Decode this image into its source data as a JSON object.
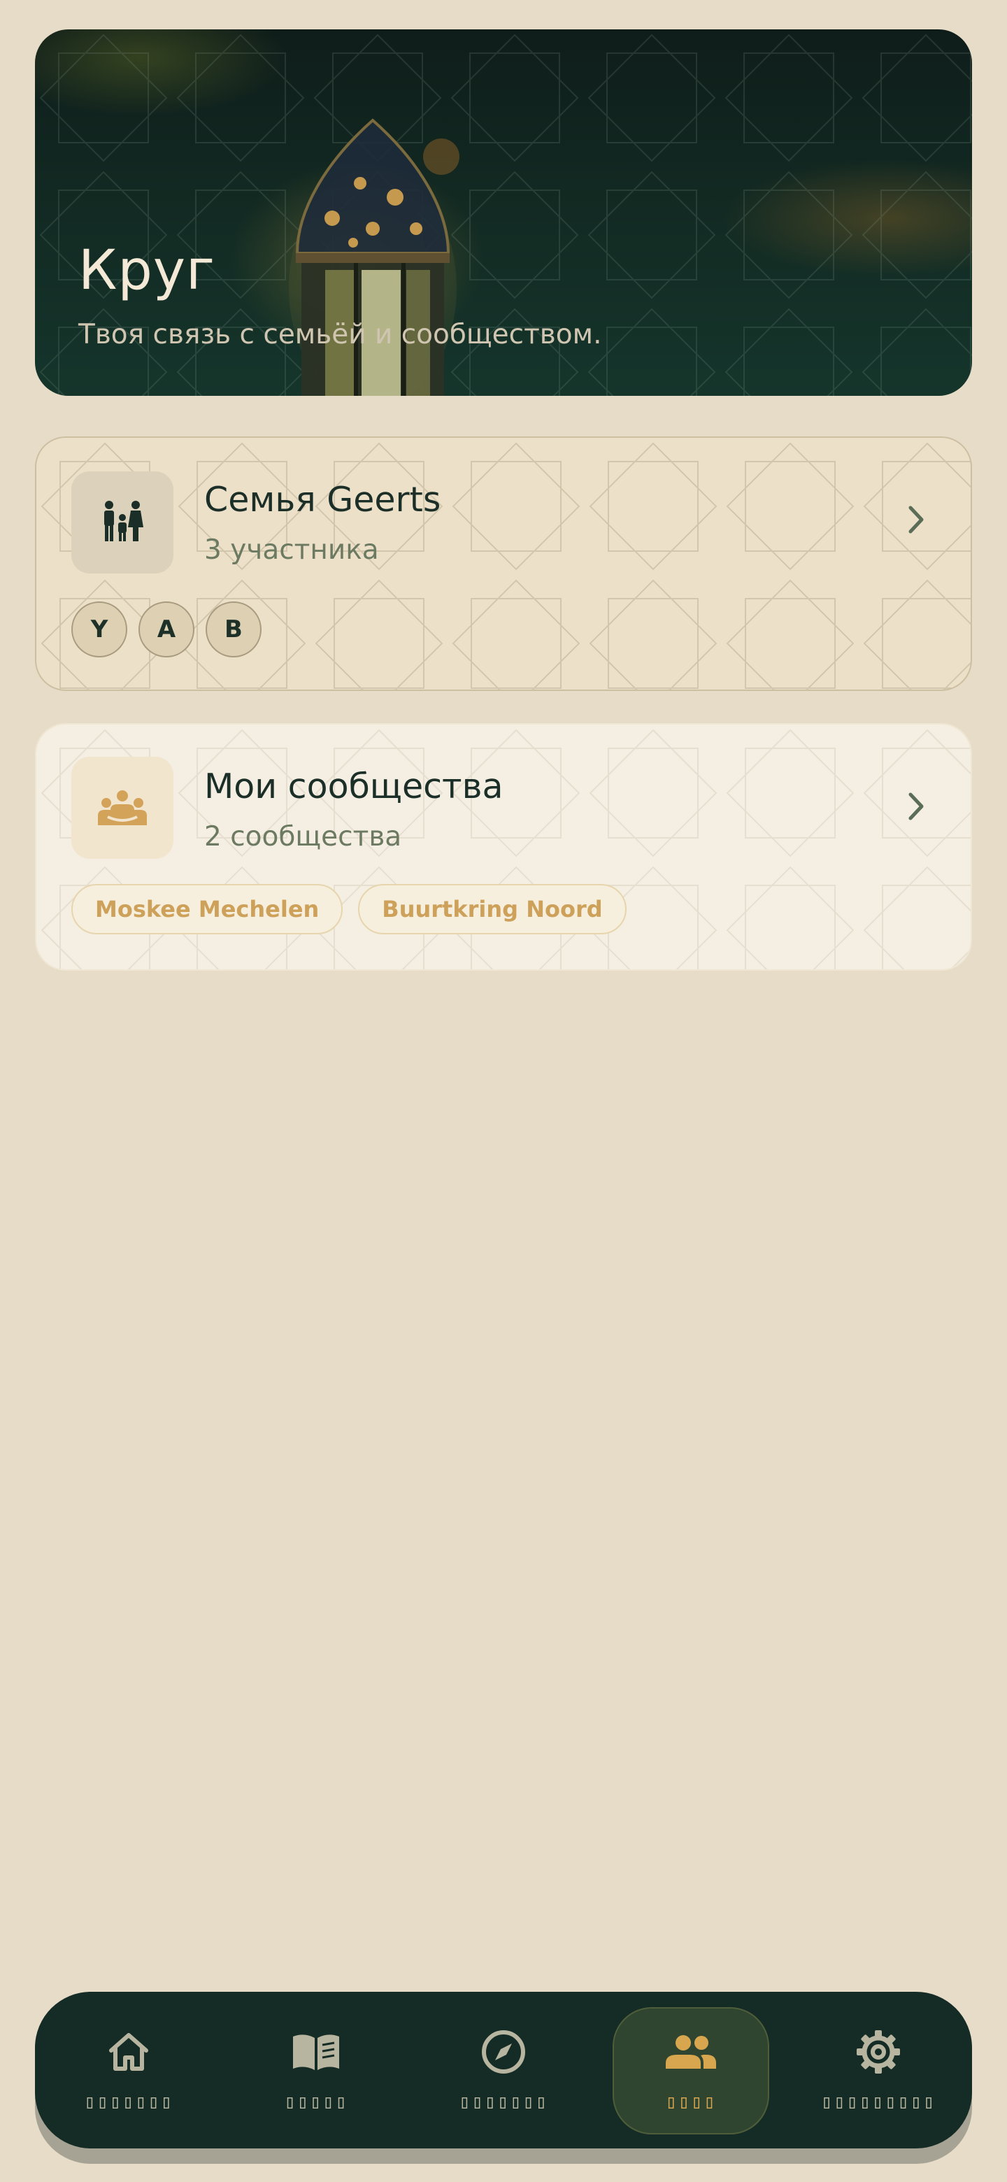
{
  "hero": {
    "title": "Круг",
    "subtitle": "Твоя связь с семьёй и сообществом."
  },
  "family_card": {
    "icon": "family-icon",
    "title": "Семья Geerts",
    "subtitle": "3 участника",
    "members": [
      "Y",
      "A",
      "B"
    ]
  },
  "communities_card": {
    "icon": "community-group-icon",
    "title": "Мои сообщества",
    "subtitle": "2 сообщества",
    "communities": [
      "Moskee Mechelen",
      "Buurtkring Noord"
    ]
  },
  "bottom_nav": {
    "items": [
      {
        "icon": "home-icon",
        "label": "▯▯▯▯▯▯▯",
        "active": false
      },
      {
        "icon": "book-icon",
        "label": "▯▯▯▯▯",
        "active": false
      },
      {
        "icon": "compass-icon",
        "label": "▯▯▯▯▯▯▯",
        "active": false
      },
      {
        "icon": "people-icon",
        "label": "▯▯▯▯",
        "active": true
      },
      {
        "icon": "gear-icon",
        "label": "▯▯▯▯▯▯▯▯▯",
        "active": false
      }
    ]
  },
  "colors": {
    "background": "#e7dcc8",
    "hero_dark": "#122922",
    "accent_gold": "#d9a650",
    "text_dark": "#1b2f28",
    "nav_background": "#142c25"
  }
}
